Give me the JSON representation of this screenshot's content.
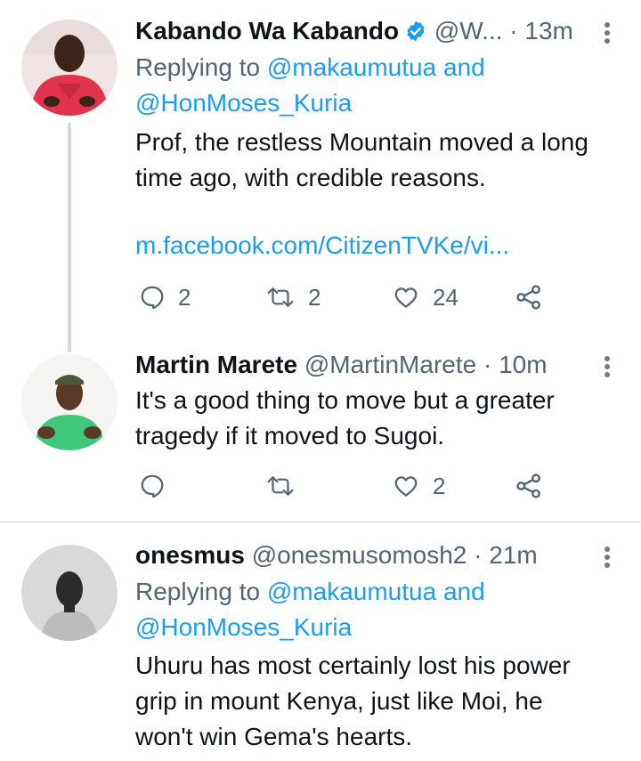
{
  "tweets": [
    {
      "name": "Kabando Wa Kabando",
      "handle": "@W...",
      "time": "· 13m",
      "replying_prefix": "Replying to ",
      "replying_user1": "@makaumutua",
      "replying_and": " and",
      "replying_user2": "@HonMoses_Kuria",
      "text_line1": "Prof, the restless Mountain moved a long",
      "text_line2": "time ago, with credible reasons.",
      "link": "m.facebook.com/CitizenTVKe/vi...",
      "replies": "2",
      "retweets": "2",
      "likes": "24"
    },
    {
      "name": "Martin Marete",
      "handle": "@MartinMarete",
      "time": "· 10m",
      "text_line1": "It's a good thing to move but a greater",
      "text_line2": "tragedy if it moved to Sugoi.",
      "replies": "",
      "retweets": "",
      "likes": "2"
    },
    {
      "name": "onesmus",
      "handle": "@onesmusomosh2",
      "time": "· 21m",
      "replying_prefix": "Replying to ",
      "replying_user1": "@makaumutua",
      "replying_and": " and",
      "replying_user2": "@HonMoses_Kuria",
      "text_line1": "Uhuru has most certainly lost his power",
      "text_line2": "grip in mount Kenya, just like Moi, he",
      "text_line3": "won't win Gema's hearts."
    }
  ],
  "colors": {
    "accent": "#1d9bf0",
    "muted": "#536471",
    "text": "#0f1419",
    "verified": "#1d9bf0"
  }
}
